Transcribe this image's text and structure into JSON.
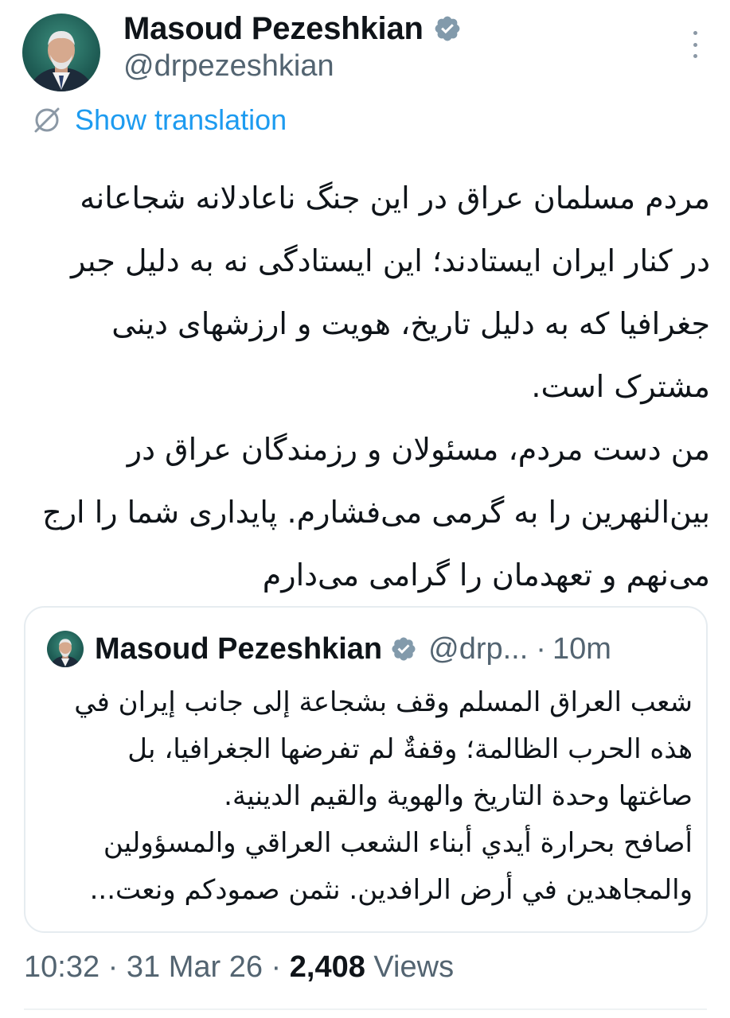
{
  "author": {
    "display_name": "Masoud Pezeshkian",
    "handle": "@drpezeshkian",
    "verified": true,
    "avatar_icon": "profile-photo"
  },
  "translation": {
    "label": "Show translation",
    "icon": "translate-icon",
    "color": "#1d9bf0"
  },
  "tweet": {
    "text": "مردم مسلمان عراق در این جنگ ناعادلانه شجاعانه\nدر کنار ایران ایستادند؛ این ایستادگی نه به دلیل جبر\nجغرافیا که به دلیل تاریخ، هویت و ارزشهای دینی\nمشترک است.\nمن دست مردم، مسئولان و رزمندگان عراق در\nبین‌النهرین را به گرمی می‌فشارم. پایداری شما را ارج\nمی‌نهم و تعهدمان را گرامی می‌دارم"
  },
  "quote": {
    "display_name": "Masoud Pezeshkian",
    "handle": "@drp...",
    "separator": "·",
    "time": "10m",
    "verified": true,
    "text": "شعب العراق المسلم وقف بشجاعة إلى جانب إيران في\nهذه الحرب الظالمة؛ وقفةٌ لم تفرضها الجغرافيا، بل\nصاغتها وحدة التاريخ والهوية والقيم الدينية.\nأصافح بحرارة أيدي أبناء الشعب العراقي والمسؤولين\nوالمجاهدين في أرض الرافدين. نثمن صمودكم ونعت..."
  },
  "meta": {
    "time": "10:32",
    "sep1": " · ",
    "date": "31 Mar 26",
    "sep2": " · ",
    "views_count": "2,408",
    "views_label": " Views"
  },
  "colors": {
    "text": "#0f1419",
    "secondary": "#536471",
    "verified_badge": "#829aab",
    "border": "#e6ecf0"
  }
}
